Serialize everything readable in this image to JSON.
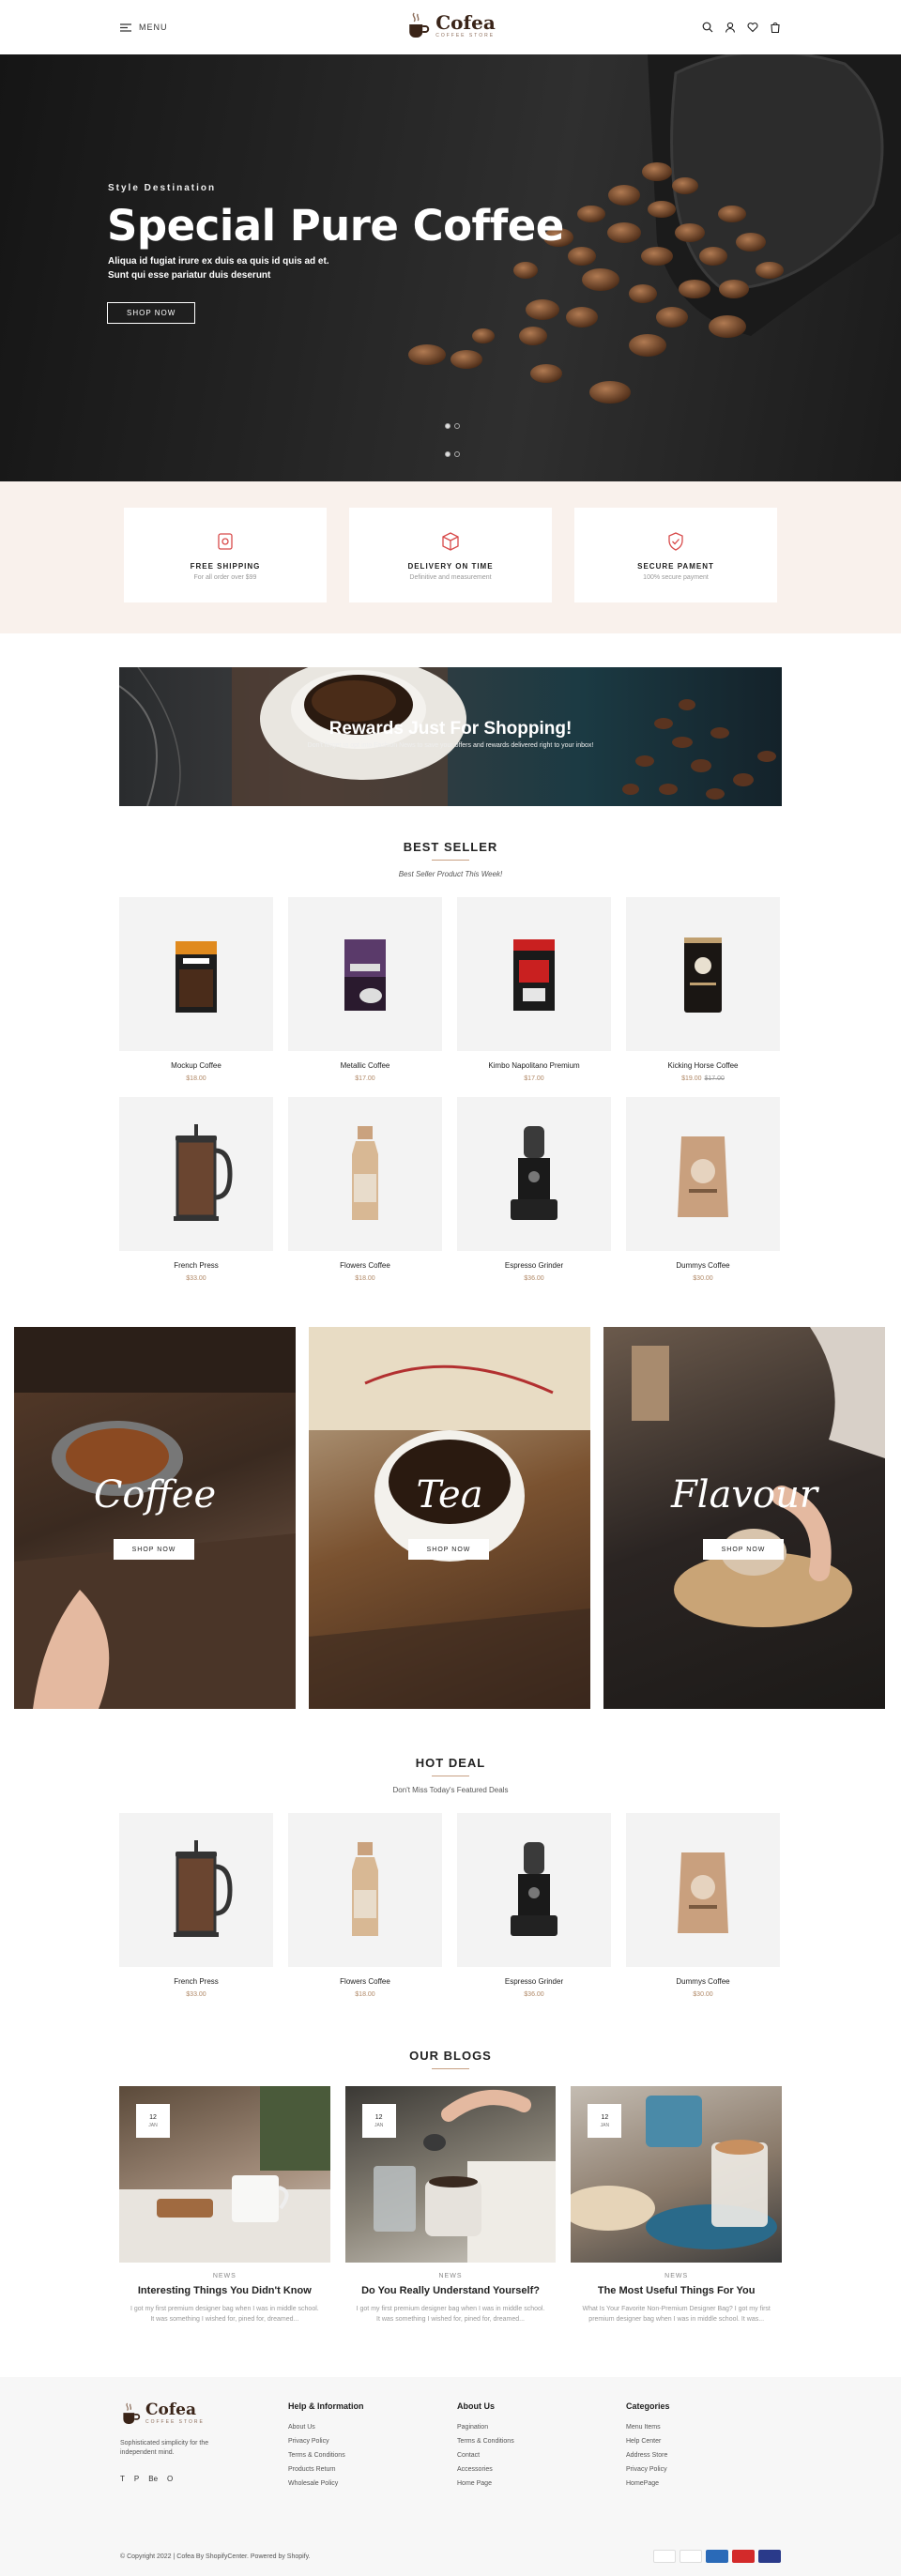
{
  "header": {
    "menu_label": "MENU",
    "logo_name": "Cofea",
    "logo_tag": "COFFEE STORE",
    "icons": [
      "search-icon",
      "user-icon",
      "heart-icon",
      "cart-icon"
    ]
  },
  "hero": {
    "kicker": "Style Destination",
    "title": "Special Pure Coffee",
    "line1": "Aliqua id fugiat irure ex duis ea quis id quis ad et.",
    "line2": "Sunt qui esse pariatur duis deserunt",
    "button": "SHOP NOW"
  },
  "features": [
    {
      "title": "FREE SHIPPING",
      "sub": "For all order over $99",
      "icon": "coffee-box-icon"
    },
    {
      "title": "DELIVERY ON TIME",
      "sub": "Definitive and measurement",
      "icon": "package-icon"
    },
    {
      "title": "SECURE PAMENT",
      "sub": "100% secure payment",
      "icon": "shield-check-icon"
    }
  ],
  "rewards": {
    "title": "Rewards Just For Shopping!",
    "sub": "Don't forget to opt into Fashion News to save your offers and rewards delivered right to your inbox!"
  },
  "best_seller": {
    "title": "BEST SELLER",
    "sub": "Best Seller Product This Week!",
    "products": [
      {
        "name": "Mockup Coffee",
        "price": "$18.00",
        "old": ""
      },
      {
        "name": "Metallic Coffee",
        "price": "$17.00",
        "old": ""
      },
      {
        "name": "Kimbo Napolitano Premium",
        "price": "$17.00",
        "old": ""
      },
      {
        "name": "Kicking Horse Coffee",
        "price": "$19.00",
        "old": "$17.00"
      },
      {
        "name": "French Press",
        "price": "$33.00",
        "old": ""
      },
      {
        "name": "Flowers Coffee",
        "price": "$18.00",
        "old": ""
      },
      {
        "name": "Espresso Grinder",
        "price": "$36.00",
        "old": ""
      },
      {
        "name": "Dummys Coffee",
        "price": "$30.00",
        "old": ""
      }
    ]
  },
  "categories": [
    {
      "name": "Coffee",
      "button": "SHOP NOW"
    },
    {
      "name": "Tea",
      "button": "SHOP NOW"
    },
    {
      "name": "Flavour",
      "button": "SHOP NOW"
    }
  ],
  "hot_deal": {
    "title": "HOT DEAL",
    "sub": "Don't Miss Today's Featured Deals",
    "products": [
      {
        "name": "French Press",
        "price": "$33.00"
      },
      {
        "name": "Flowers Coffee",
        "price": "$18.00"
      },
      {
        "name": "Espresso Grinder",
        "price": "$36.00"
      },
      {
        "name": "Dummys Coffee",
        "price": "$30.00"
      }
    ]
  },
  "blogs": {
    "title": "OUR BLOGS",
    "posts": [
      {
        "day": "12",
        "month": "JAN",
        "tag": "NEWS",
        "title": "Interesting Things You Didn't Know",
        "l1": "I got my first premium designer bag when I was in middle school.",
        "l2": "It was something I wished for, pined for, dreamed..."
      },
      {
        "day": "12",
        "month": "JAN",
        "tag": "NEWS",
        "title": "Do You Really Understand Yourself?",
        "l1": "I got my first premium designer bag when I was in middle school.",
        "l2": "It was something I wished for, pined for, dreamed..."
      },
      {
        "day": "12",
        "month": "JAN",
        "tag": "NEWS",
        "title": "The Most Useful Things For You",
        "l1": "What Is Your Favorite Non-Premium Designer Bag? I got my first",
        "l2": "premium designer bag when I was in middle school. It was..."
      }
    ]
  },
  "footer": {
    "about": "Sophisticated simplicity for the independent mind.",
    "social": [
      "T",
      "P",
      "Be",
      "O"
    ],
    "cols": [
      {
        "title": "Help & Information",
        "items": [
          "About Us",
          "Privacy Policy",
          "Terms & Conditions",
          "Products Return",
          "Wholesale Policy"
        ]
      },
      {
        "title": "About Us",
        "items": [
          "Pagination",
          "Terms & Conditions",
          "Contact",
          "Accessories",
          "Home Page"
        ]
      },
      {
        "title": "Categories",
        "items": [
          "Menu Items",
          "Help Center",
          "Address Store",
          "Privacy Policy",
          "HomePage"
        ]
      }
    ],
    "copyright": "© Copyright 2022 | Cofea By ShopifyCenter. Powered by Shopify.",
    "payments": [
      "visa-icon",
      "paypal-icon",
      "amex-icon",
      "mastercard-icon",
      "discover-icon"
    ]
  }
}
